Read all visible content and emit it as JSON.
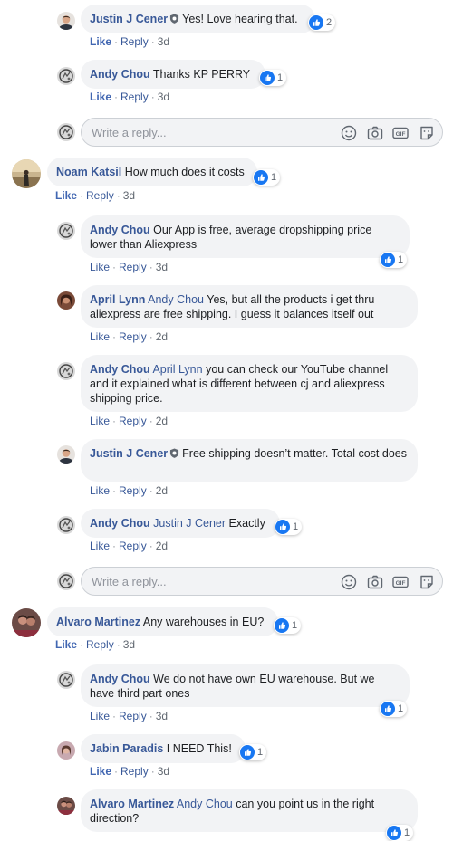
{
  "placeholder": "Write a reply...",
  "actions": {
    "like": "Like",
    "reply": "Reply"
  },
  "comments": [
    {
      "name": "Justin J Cener",
      "text": "Yes! Love hearing that.",
      "reactions": "2",
      "time": "3d"
    },
    {
      "name": "Andy Chou",
      "text": "Thanks KP PERRY",
      "reactions": "1",
      "time": "3d"
    },
    {
      "name": "Noam Katsil",
      "text": "How much does it costs",
      "reactions": "1",
      "time": "3d"
    },
    {
      "name": "Andy Chou",
      "text": "Our App is free, average dropshipping price lower than Aliexpress",
      "reactions": "1",
      "time": "3d"
    },
    {
      "name": "April Lynn",
      "mention": "Andy Chou",
      "text": "Yes, but all the products i get thru aliexpress are free shipping. I guess it balances itself out",
      "time": "2d"
    },
    {
      "name": "Andy Chou",
      "mention": "April Lynn",
      "text": "you can check our YouTube channel and it explained what is different between cj and aliexpress shipping price.",
      "time": "2d"
    },
    {
      "name": "Justin J Cener",
      "text": "Free shipping doesn’t matter. Total cost does",
      "time": "2d"
    },
    {
      "name": "Andy Chou",
      "mention": "Justin J Cener",
      "text": "Exactly",
      "reactions": "1",
      "time": "2d"
    },
    {
      "name": "Alvaro Martinez",
      "text": "Any warehouses in EU?",
      "reactions": "1",
      "time": "3d"
    },
    {
      "name": "Andy Chou",
      "text": "We do not have own EU warehouse. But we have third part ones",
      "reactions": "1",
      "time": "3d"
    },
    {
      "name": "Jabin Paradis",
      "text": "I NEED This!",
      "reactions": "1",
      "time": "3d"
    },
    {
      "name": "Alvaro Martinez",
      "mention": "Andy Chou",
      "text": "can you point us in the right direction?",
      "reactions": "1"
    }
  ],
  "icons": [
    "like-icon",
    "emoji-icon",
    "camera-icon",
    "gif-icon",
    "sticker-icon",
    "verified-shield-icon"
  ],
  "colors": {
    "name": "#385898",
    "like": "#4267b2",
    "bubble": "#f2f3f5",
    "reaction": "#1877f2"
  }
}
